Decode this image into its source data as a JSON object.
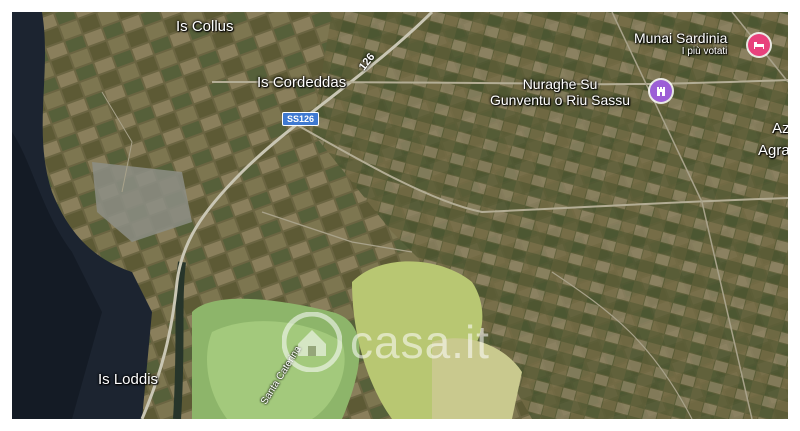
{
  "map": {
    "places": {
      "is_collus": "Is Collus",
      "is_cordeddas": "Is Cordeddas",
      "is_loddis": "Is Loddis",
      "munai_sardinia": "Munai Sardinia",
      "munai_sub": "I più votati",
      "nuraghe_line1": "Nuraghe Su",
      "nuraghe_line2": "Gunventu o Riu Sassu",
      "az_partial": "Az",
      "agra_partial": "Agra"
    },
    "roads": {
      "shield": "SS126",
      "road_number": "126",
      "street_santa_caterina": "Santa Caterina"
    },
    "watermark": "casa.it",
    "colors": {
      "pin_hotel": "#e8417c",
      "pin_landmark": "#9c5fd6",
      "shield_blue": "#3f79d1"
    },
    "icons": {
      "hotel": "bed-icon",
      "landmark": "castle-icon",
      "watermark_logo": "house-icon"
    }
  }
}
